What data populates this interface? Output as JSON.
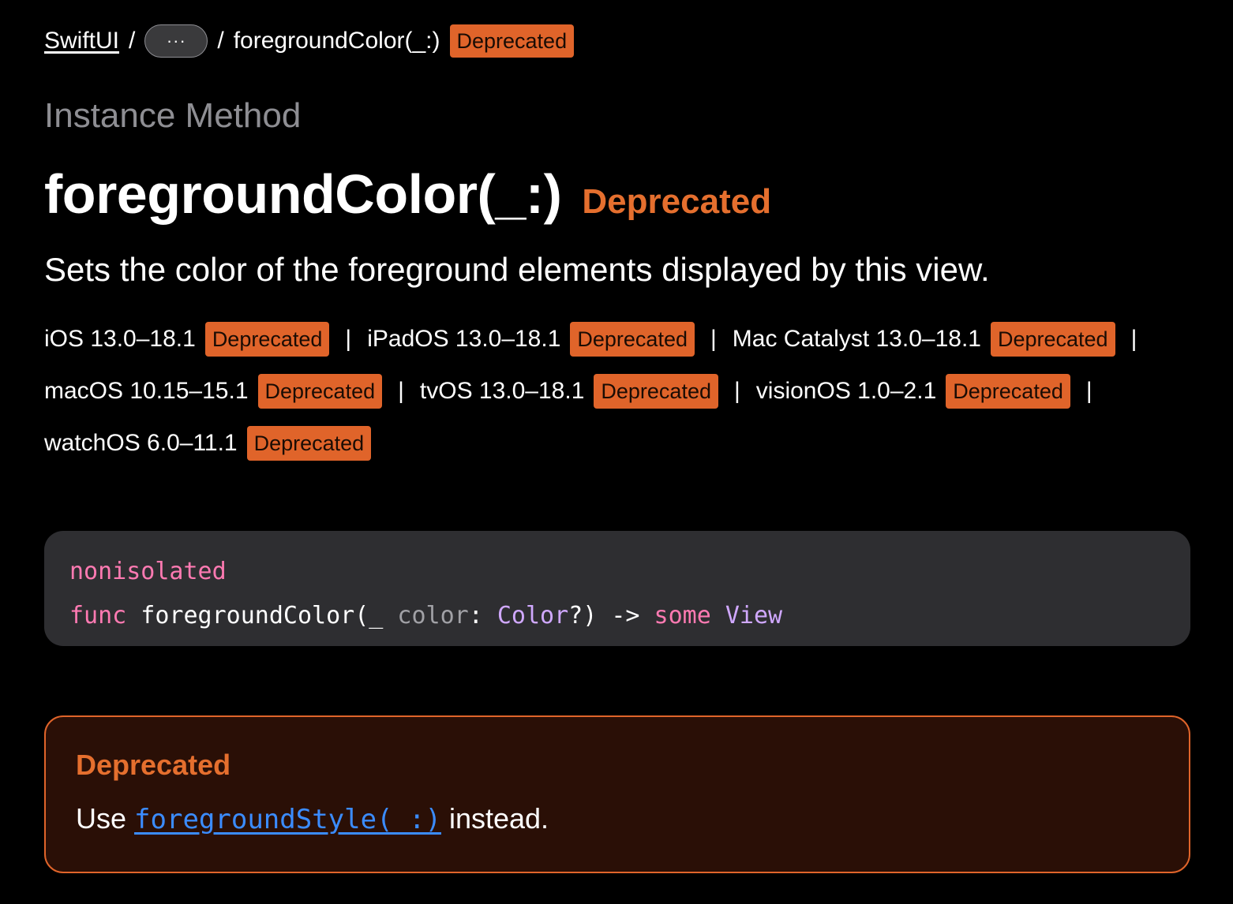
{
  "breadcrumb": {
    "root": "SwiftUI",
    "separator": "/",
    "more": "···",
    "current": "foregroundColor(_:)",
    "badge": "Deprecated"
  },
  "header": {
    "eyebrow": "Instance Method",
    "title": "foregroundColor(_:)",
    "title_badge": "Deprecated",
    "abstract": "Sets the color of the foreground elements displayed by this view."
  },
  "platforms": [
    {
      "name": "iOS 13.0–18.1",
      "badge": "Deprecated"
    },
    {
      "name": "iPadOS 13.0–18.1",
      "badge": "Deprecated"
    },
    {
      "name": "Mac Catalyst 13.0–18.1",
      "badge": "Deprecated"
    },
    {
      "name": "macOS 10.15–15.1",
      "badge": "Deprecated"
    },
    {
      "name": "tvOS 13.0–18.1",
      "badge": "Deprecated"
    },
    {
      "name": "visionOS 1.0–2.1",
      "badge": "Deprecated"
    },
    {
      "name": "watchOS 6.0–11.1",
      "badge": "Deprecated"
    }
  ],
  "declaration": {
    "line1": "nonisolated",
    "kw_func": "func",
    "name": " foregroundColor(_ ",
    "param": "color",
    "colon": ": ",
    "type": "Color",
    "rest": "?) -> ",
    "kw_some": "some",
    "return_type": " View"
  },
  "callout": {
    "title": "Deprecated",
    "prefix": "Use ",
    "link": "foregroundStyle(_:)",
    "suffix": " instead."
  },
  "colors": {
    "background": "#000000",
    "badge": "#e0642a",
    "deprecated_text": "#e56f2e",
    "link": "#3b8cff",
    "code_background": "#2e2e31",
    "keyword": "#ff7ab2",
    "type": "#d0a8ff"
  }
}
